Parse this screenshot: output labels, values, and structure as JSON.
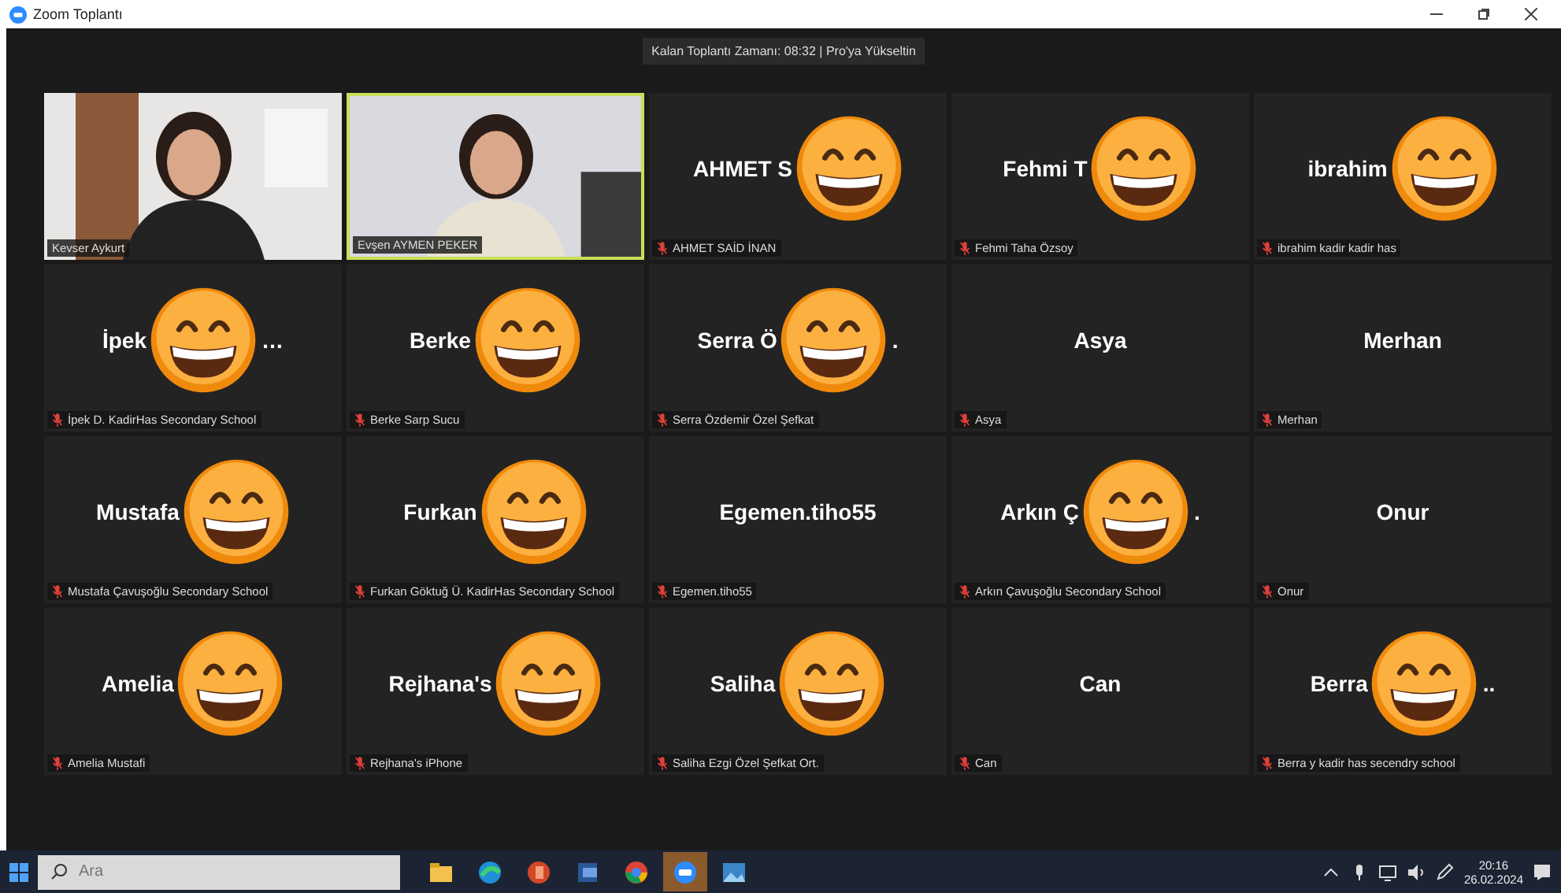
{
  "window": {
    "title": "Zoom Toplantı"
  },
  "banner": {
    "text": "Kalan Toplantı Zamanı: 08:32 | Pro'ya Yükseltin"
  },
  "tiles": [
    {
      "kind": "video",
      "label": "Kevser Aykurt",
      "selected": false,
      "muted": false
    },
    {
      "kind": "video",
      "label": "Evşen AYMEN PEKER",
      "selected": true,
      "muted": false
    },
    {
      "kind": "name",
      "big": "AHMET S",
      "sticker": true,
      "label": "AHMET SAİD İNAN",
      "selected": false,
      "muted": true
    },
    {
      "kind": "name",
      "big": "Fehmi T",
      "sticker": true,
      "label": "Fehmi Taha Özsoy",
      "selected": false,
      "muted": true
    },
    {
      "kind": "name",
      "big": "ibrahim",
      "sticker": true,
      "label": "ibrahim kadir kadir has",
      "selected": false,
      "muted": true
    },
    {
      "kind": "name",
      "big": "İpek",
      "tail": "…",
      "sticker": true,
      "label": "İpek D. KadirHas Secondary School",
      "selected": false,
      "muted": true
    },
    {
      "kind": "name",
      "big": "Berke",
      "sticker": true,
      "label": "Berke Sarp Sucu",
      "selected": false,
      "muted": true
    },
    {
      "kind": "name",
      "big": "Serra Ö",
      "tail": ".",
      "sticker": true,
      "label": "Serra Özdemir Özel Şefkat",
      "selected": false,
      "muted": true
    },
    {
      "kind": "name",
      "big": "Asya",
      "sticker": false,
      "label": "Asya",
      "selected": false,
      "muted": true
    },
    {
      "kind": "name",
      "big": "Merhan",
      "sticker": false,
      "label": "Merhan",
      "selected": false,
      "muted": true
    },
    {
      "kind": "name",
      "big": "Mustafa",
      "sticker": true,
      "label": "Mustafa Çavuşoğlu Secondary School",
      "selected": false,
      "muted": true
    },
    {
      "kind": "name",
      "big": "Furkan",
      "sticker": true,
      "label": "Furkan Göktuğ Ü. KadirHas Secondary School",
      "selected": false,
      "muted": true
    },
    {
      "kind": "name",
      "big": "Egemen.tiho55",
      "sticker": false,
      "label": "Egemen.tiho55",
      "selected": false,
      "muted": true
    },
    {
      "kind": "name",
      "big": "Arkın Ç",
      "tail": ".",
      "sticker": true,
      "label": "Arkın Çavuşoğlu Secondary School",
      "selected": false,
      "muted": true
    },
    {
      "kind": "name",
      "big": "Onur",
      "sticker": false,
      "label": "Onur",
      "selected": false,
      "muted": true
    },
    {
      "kind": "name",
      "big": "Amelia",
      "sticker": true,
      "label": "Amelia Mustafi",
      "selected": false,
      "muted": true
    },
    {
      "kind": "name",
      "big": "Rejhana's",
      "sticker": true,
      "label": "Rejhana's iPhone",
      "selected": false,
      "muted": true
    },
    {
      "kind": "name",
      "big": "Saliha",
      "sticker": true,
      "label": "Saliha Ezgi Özel Şefkat Ort.",
      "selected": false,
      "muted": true
    },
    {
      "kind": "name",
      "big": "Can",
      "sticker": false,
      "label": "Can",
      "selected": false,
      "muted": true
    },
    {
      "kind": "name",
      "big": "Berra",
      "tail": "..",
      "sticker": true,
      "label": "Berra y kadir has secendry school",
      "selected": false,
      "muted": true
    }
  ],
  "taskbar": {
    "search": {
      "placeholder": "Ara"
    },
    "apps": [
      {
        "kind": "files",
        "selected": false
      },
      {
        "kind": "browser",
        "selected": false
      },
      {
        "kind": "slides",
        "selected": false
      },
      {
        "kind": "word",
        "selected": false
      },
      {
        "kind": "chrome",
        "selected": false
      },
      {
        "kind": "zoom",
        "selected": true
      },
      {
        "kind": "photos",
        "selected": false
      }
    ],
    "time": "20:16",
    "date": "26.02.2024"
  }
}
